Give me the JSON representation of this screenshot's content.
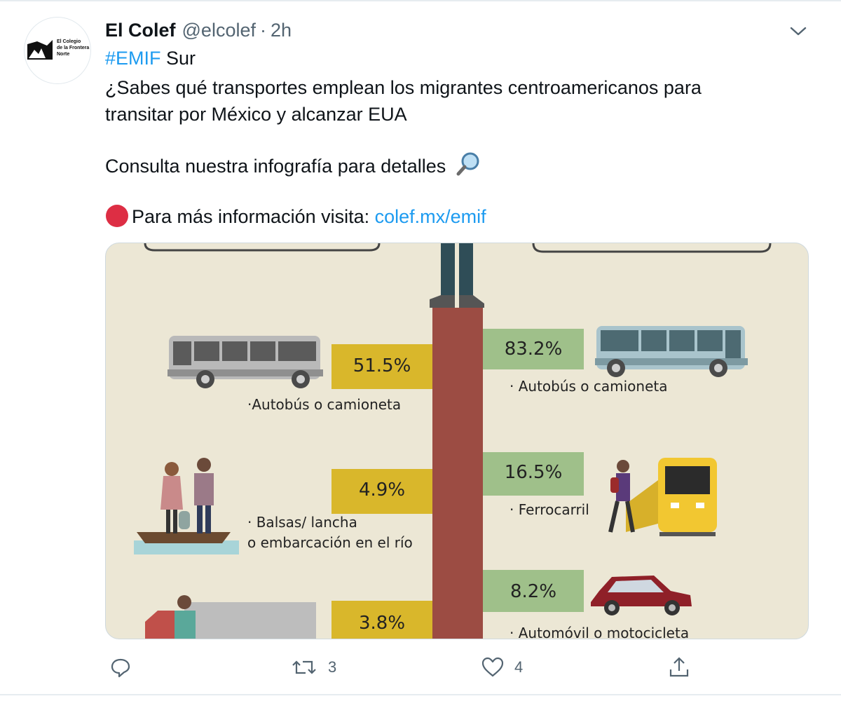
{
  "tweet": {
    "author_name": "El Colef",
    "author_handle": "@elcolef",
    "separator": "·",
    "timestamp": "2h",
    "avatar_logo_text": [
      "El Colegio",
      "de la Frontera",
      "Norte"
    ],
    "hashtag": "#EMIF",
    "line1_rest": " Sur",
    "line2": "¿Sabes qué transportes emplean los migrantes centroamericanos para",
    "line3": "transitar por México y alcanzar EUA",
    "line4": "Consulta nuestra infografía para detalles",
    "line5_prefix": "Para más información visita: ",
    "line5_link": "colef.mx/emif"
  },
  "infographic": {
    "left": [
      {
        "percent": "51.5%",
        "label_lines": [
          "·Autobús o camioneta"
        ]
      },
      {
        "percent": "4.9%",
        "label_lines": [
          "· Balsas/ lancha",
          "o embarcación en el río"
        ]
      },
      {
        "percent": "3.8%",
        "label_lines": []
      }
    ],
    "right": [
      {
        "percent": "83.2%",
        "label_lines": [
          "· Autobús o camioneta"
        ]
      },
      {
        "percent": "16.5%",
        "label_lines": [
          "· Ferrocarril"
        ]
      },
      {
        "percent": "8.2%",
        "label_lines": [
          "· Automóvil o motocicleta"
        ]
      }
    ],
    "colors": {
      "background": "#ece7d5",
      "left_box": "#d9b72b",
      "right_box": "#9fc08a",
      "center_pillar": "#9c4c43"
    }
  },
  "actions": {
    "reply_icon": "reply-icon",
    "retweet_icon": "retweet-icon",
    "retweet_count": "3",
    "like_icon": "heart-icon",
    "like_count": "4",
    "share_icon": "share-icon"
  },
  "colors": {
    "link": "#1d9bf0",
    "text": "#0f1419",
    "muted": "#536471"
  }
}
